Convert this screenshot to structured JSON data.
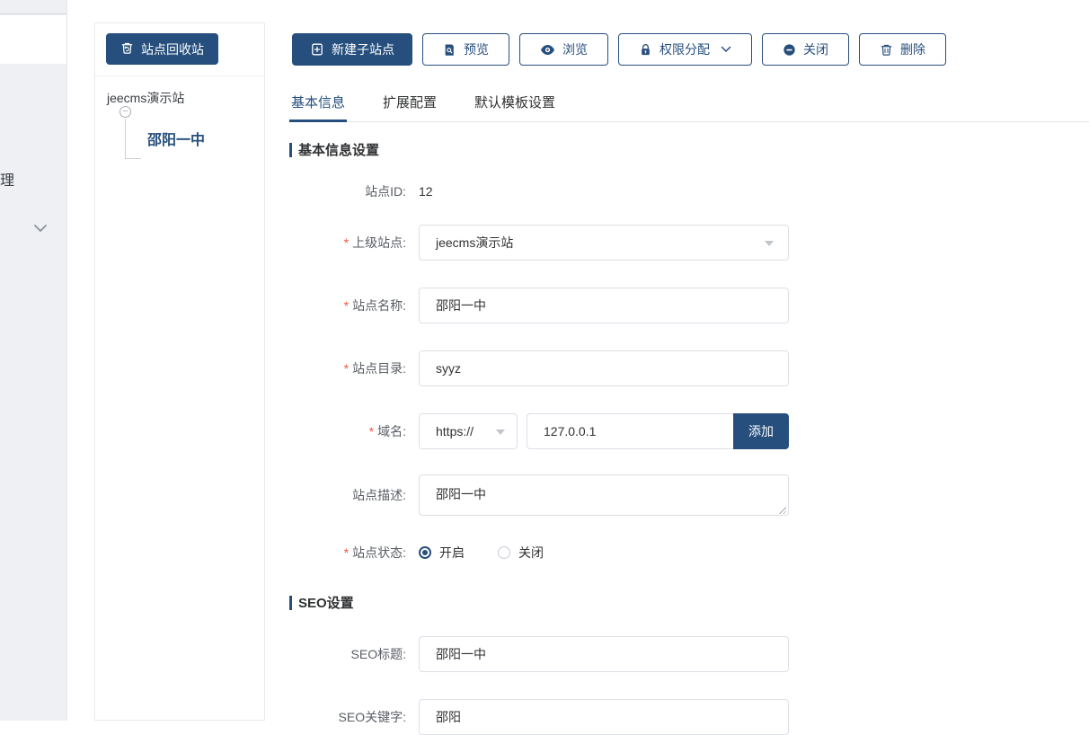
{
  "colors": {
    "brand": "#274f7d",
    "input_border": "#dcdfe6",
    "sidebar_bg": "#eef0f3"
  },
  "left_nav": {
    "clipped_item": "理",
    "collapse_icon": "chevron-down"
  },
  "site_tree": {
    "recycle_button": "站点回收站",
    "root_label": "jeecms演示站",
    "toggle_glyph": "−",
    "child_label": "邵阳一中"
  },
  "toolbar": {
    "new_sub_site": "新建子站点",
    "preview": "预览",
    "browse": "浏览",
    "permissions": "权限分配",
    "close": "关闭",
    "delete": "删除"
  },
  "tabs": [
    {
      "label": "基本信息",
      "active": true
    },
    {
      "label": "扩展配置",
      "active": false
    },
    {
      "label": "默认模板设置",
      "active": false
    }
  ],
  "required_mark": "*",
  "basic_section": {
    "title": "基本信息设置",
    "site_id": {
      "label": "站点ID:",
      "value": "12"
    },
    "parent_site": {
      "label": "上级站点:",
      "value": "jeecms演示站"
    },
    "site_name": {
      "label": "站点名称:",
      "value": "邵阳一中"
    },
    "site_dir": {
      "label": "站点目录:",
      "value": "syyz"
    },
    "domain": {
      "label": "域名:",
      "protocol": "https://",
      "value": "127.0.0.1",
      "add_button": "添加"
    },
    "site_desc": {
      "label": "站点描述:",
      "value": "邵阳一中"
    },
    "site_status": {
      "label": "站点状态:",
      "option_on": "开启",
      "option_off": "关闭",
      "selected": "开启"
    }
  },
  "seo_section": {
    "title": "SEO设置",
    "seo_title": {
      "label": "SEO标题:",
      "value": "邵阳一中"
    },
    "seo_keywords": {
      "label": "SEO关键字:",
      "value": "邵阳"
    }
  }
}
